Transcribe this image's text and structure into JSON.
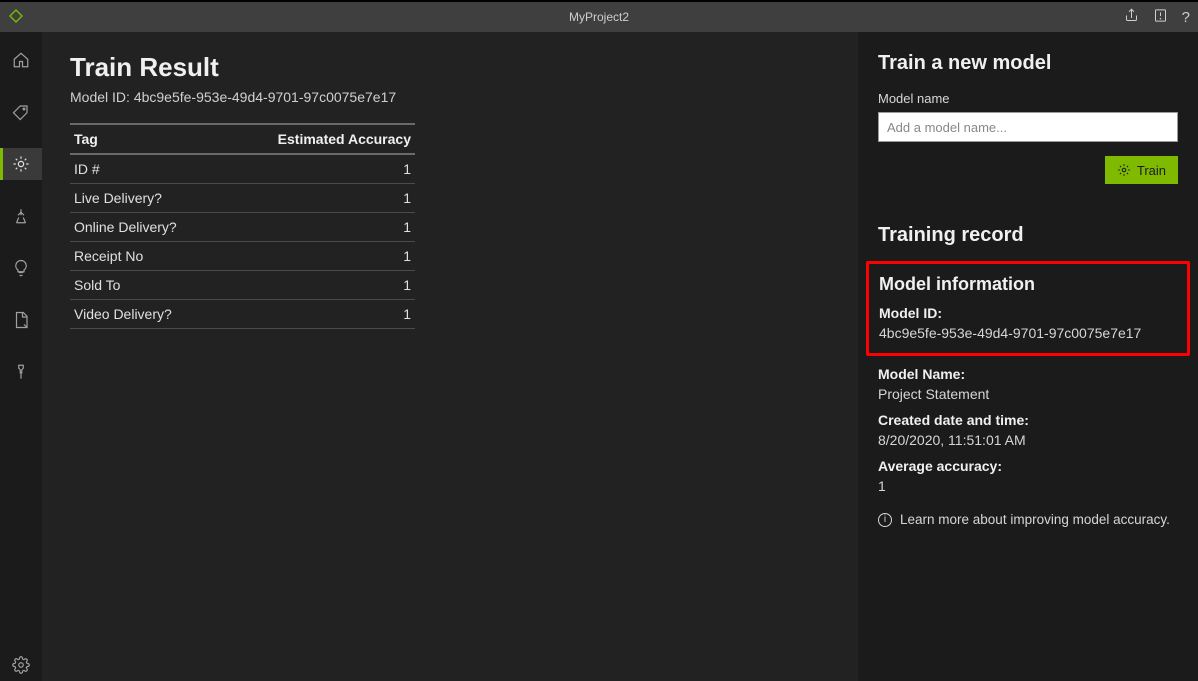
{
  "titlebar": {
    "project": "MyProject2"
  },
  "main": {
    "heading": "Train Result",
    "model_id_label": "Model ID: ",
    "model_id": "4bc9e5fe-953e-49d4-9701-97c0075e7e17",
    "table": {
      "headers": {
        "tag": "Tag",
        "accuracy": "Estimated Accuracy"
      },
      "rows": [
        {
          "tag": "ID #",
          "accuracy": "1"
        },
        {
          "tag": "Live Delivery?",
          "accuracy": "1"
        },
        {
          "tag": "Online Delivery?",
          "accuracy": "1"
        },
        {
          "tag": "Receipt No",
          "accuracy": "1"
        },
        {
          "tag": "Sold To",
          "accuracy": "1"
        },
        {
          "tag": "Video Delivery?",
          "accuracy": "1"
        }
      ]
    }
  },
  "right": {
    "train_heading": "Train a new model",
    "model_name_label": "Model name",
    "model_name_placeholder": "Add a model name...",
    "train_button": "Train",
    "record_heading": "Training record",
    "model_info_heading": "Model information",
    "labels": {
      "model_id": "Model ID:",
      "model_name": "Model Name:",
      "created": "Created date and time:",
      "avg_accuracy": "Average accuracy:"
    },
    "values": {
      "model_id": "4bc9e5fe-953e-49d4-9701-97c0075e7e17",
      "model_name": "Project Statement",
      "created": "8/20/2020, 11:51:01 AM",
      "avg_accuracy": "1"
    },
    "learn_more": "Learn more about improving model accuracy."
  }
}
